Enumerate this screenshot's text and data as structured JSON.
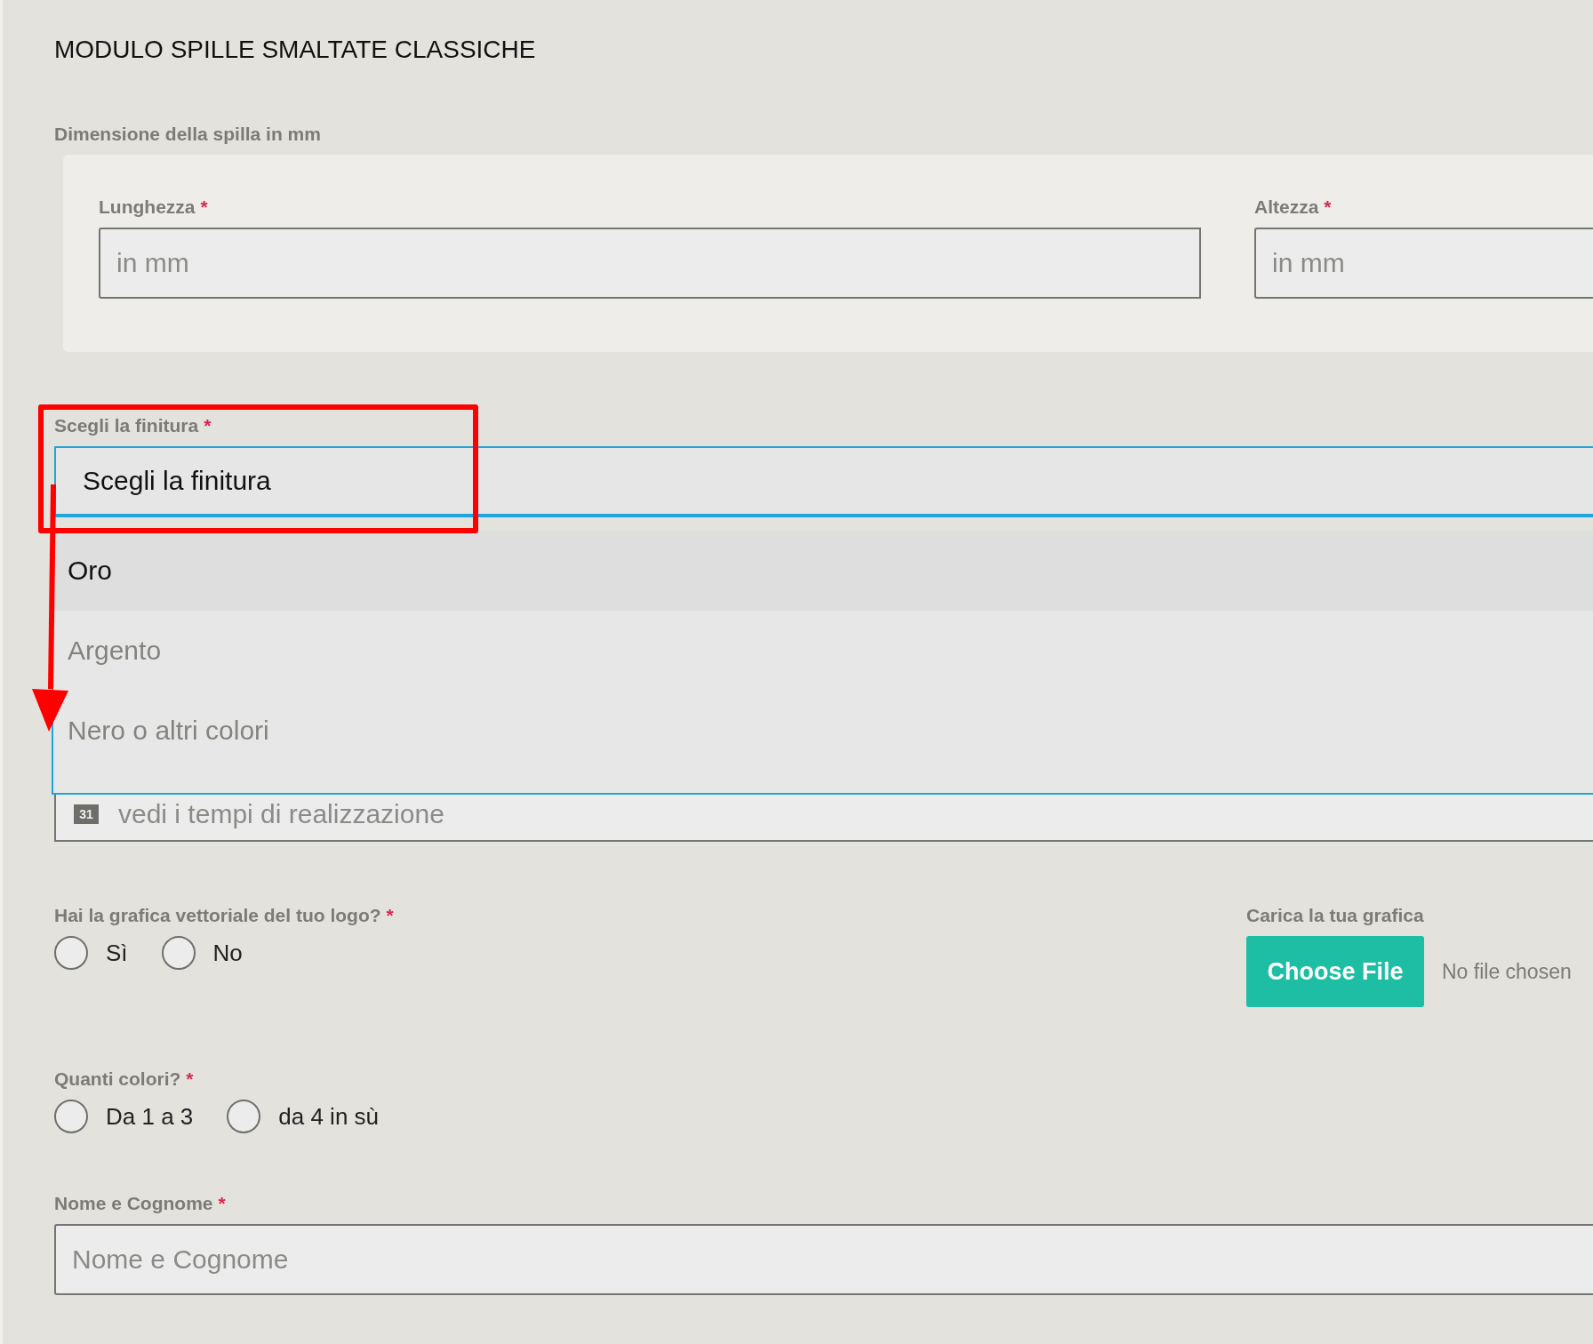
{
  "title": "MODULO SPILLE SMALTATE CLASSICHE",
  "dimensions": {
    "label": "Dimensione della spilla in mm",
    "fields": [
      {
        "label": "Lunghezza",
        "required_mark": "*",
        "placeholder": "in mm"
      },
      {
        "label": "Altezza",
        "required_mark": "*",
        "placeholder": "in mm"
      }
    ]
  },
  "finish": {
    "label": "Scegli la finitura",
    "required_mark": "*",
    "value": "Scegli la finitura",
    "expanded": true,
    "options": [
      {
        "label": "Oro",
        "highlighted": true
      },
      {
        "label": "Argento",
        "highlighted": false
      },
      {
        "label": "Nero o altri colori",
        "highlighted": false
      }
    ]
  },
  "date_field": {
    "placeholder": "vedi i tempi di realizzazione",
    "icon_text": "31"
  },
  "vector": {
    "label": "Hai la grafica vettoriale del tuo logo?",
    "required_mark": "*",
    "options": [
      {
        "label": "Sì",
        "selected": false
      },
      {
        "label": "No",
        "selected": false
      }
    ]
  },
  "upload": {
    "label": "Carica la tua grafica",
    "button": "Choose File",
    "status": "No file chosen"
  },
  "colors": {
    "label": "Quanti colori?",
    "required_mark": "*",
    "options": [
      {
        "label": "Da 1 a 3",
        "selected": false
      },
      {
        "label": "da 4 in sù",
        "selected": false
      }
    ]
  },
  "name": {
    "label": "Nome e Cognome",
    "required_mark": "*",
    "placeholder": "Nome e Cognome"
  }
}
